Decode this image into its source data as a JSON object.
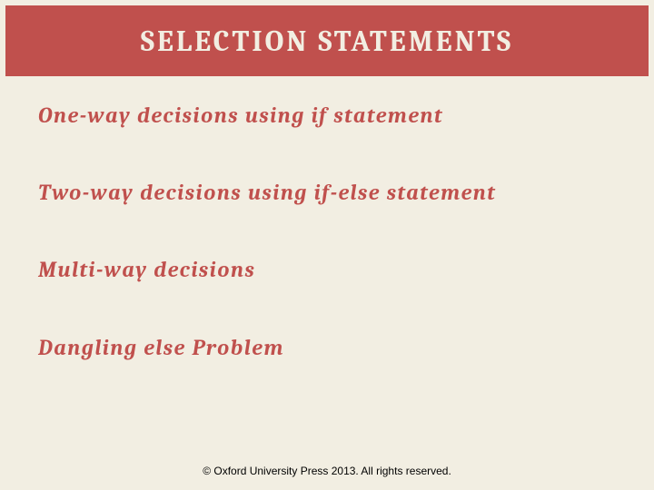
{
  "title": "SELECTION STATEMENTS",
  "topics": {
    "t1": "One-way decisions using if statement",
    "t2": "Two-way decisions using if-else statement",
    "t3": "Multi-way decisions",
    "t4": "Dangling else Problem"
  },
  "footer": "© Oxford University Press 2013. All rights reserved."
}
